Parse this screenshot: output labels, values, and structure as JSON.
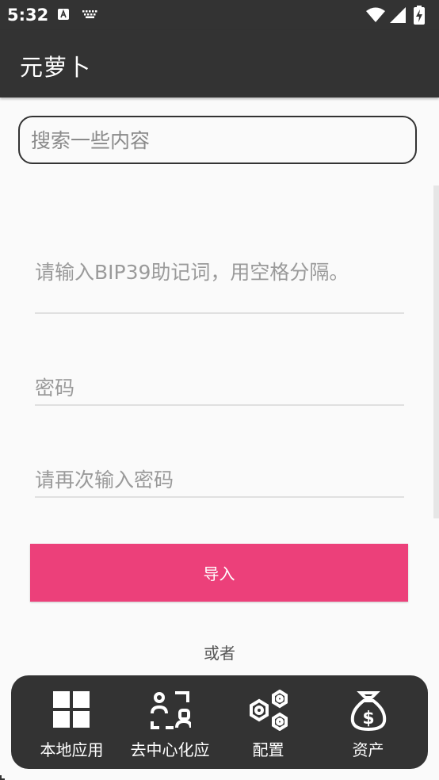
{
  "status_bar": {
    "time": "5:32",
    "icons": [
      "text-a-icon",
      "keyboard-icon",
      "wifi-icon",
      "signal-icon",
      "battery-icon"
    ]
  },
  "app_bar": {
    "title": "元萝卜"
  },
  "search": {
    "placeholder": "搜索一些内容",
    "value": ""
  },
  "form": {
    "mnemonic_placeholder": "请输入BIP39助记词，用空格分隔。",
    "password_placeholder": "密码",
    "confirm_password_placeholder": "请再次输入密码",
    "import_label": "导入",
    "or_label": "或者"
  },
  "bottom_nav": {
    "items": [
      {
        "label": "本地应用",
        "icon": "grid-icon"
      },
      {
        "label": "去中心化应",
        "icon": "decentralized-people-icon"
      },
      {
        "label": "配置",
        "icon": "hexagon-nuts-icon"
      },
      {
        "label": "资产",
        "icon": "money-bag-icon"
      }
    ]
  },
  "colors": {
    "bar": "#333333",
    "accent": "#ec407a",
    "background": "#fafafa"
  }
}
